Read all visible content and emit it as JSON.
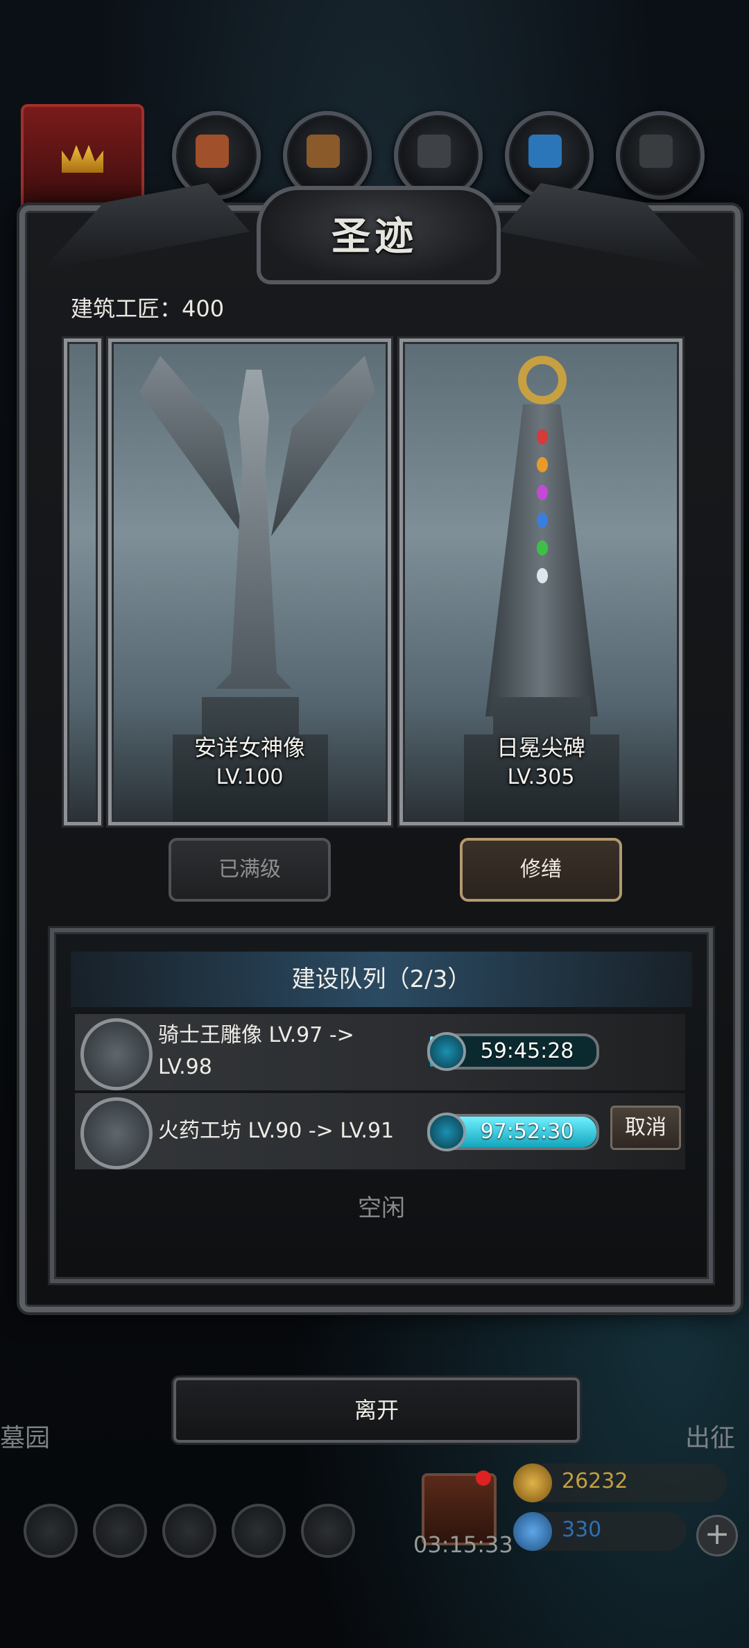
{
  "window": {
    "title": "圣迹",
    "builders_label": "建筑工匠：400"
  },
  "cards": [
    {
      "name": "安详女神像",
      "level": "LV.100",
      "button": "已满级",
      "button_enabled": false
    },
    {
      "name": "日冕尖碑",
      "level": "LV.305",
      "button": "修缮",
      "button_enabled": true
    }
  ],
  "queue": {
    "title": "建设队列（2/3）",
    "rows": [
      {
        "text": "骑士王雕像 LV.97 -> LV.98",
        "timer": "59:45:28",
        "progress": 0.02,
        "cancel": ""
      },
      {
        "text": "火药工坊 LV.90 -> LV.91",
        "timer": "97:52:30",
        "progress": 1.0,
        "cancel": "取消"
      }
    ],
    "idle_label": "空闲"
  },
  "leave_button": "离开",
  "hud": {
    "left_label": "墓园",
    "right_label": "出征",
    "gift_timer": "03:15:33",
    "gold": "26232",
    "gems": "330",
    "plus": "+"
  },
  "colors": {
    "accent_cyan": "#14a6bd",
    "repair_border": "#b39970",
    "gold_text": "#c2a040",
    "gem_text": "#2f6fb3"
  }
}
